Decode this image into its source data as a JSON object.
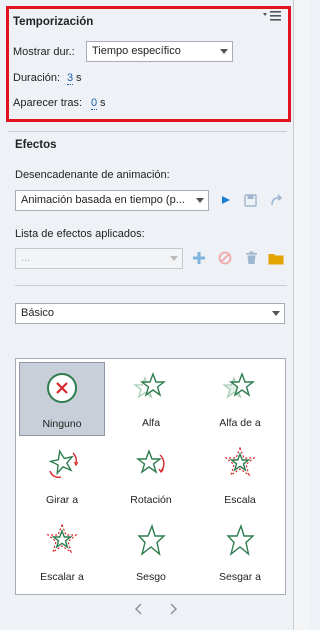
{
  "timing": {
    "title": "Temporización",
    "duration_mode_label": "Mostrar dur.:",
    "duration_mode_value": "Tiempo específico",
    "duration_label": "Duración:",
    "duration_value": "3",
    "duration_unit": "s",
    "appear_label": "Aparecer tras:",
    "appear_value": "0",
    "appear_unit": "s"
  },
  "effects": {
    "title": "Efectos",
    "trigger_label": "Desencadenante de animación:",
    "trigger_value": "Animación basada en tiempo (p...",
    "applied_label": "Lista de efectos aplicados:",
    "applied_value": "...",
    "category_value": "Básico",
    "items": [
      {
        "label": "Ninguno",
        "icon": "none-icon",
        "selected": true
      },
      {
        "label": "Alfa",
        "icon": "alpha-star-icon"
      },
      {
        "label": "Alfa de a",
        "icon": "alpha-from-to-star-icon"
      },
      {
        "label": "Girar a",
        "icon": "rotate-to-star-icon"
      },
      {
        "label": "Rotación",
        "icon": "rotation-star-icon"
      },
      {
        "label": "Escala",
        "icon": "scale-star-icon"
      },
      {
        "label": "Escalar a",
        "icon": "scale-to-star-icon"
      },
      {
        "label": "Sesgo",
        "icon": "skew-star-icon"
      },
      {
        "label": "Sesgar a",
        "icon": "skew-to-star-icon"
      }
    ]
  },
  "colors": {
    "highlight_border": "#e1131f",
    "link_blue": "#1b5fb0",
    "star_green": "#2e7d4f",
    "accent_red": "#d9262b",
    "folder_yellow": "#e3a400"
  }
}
